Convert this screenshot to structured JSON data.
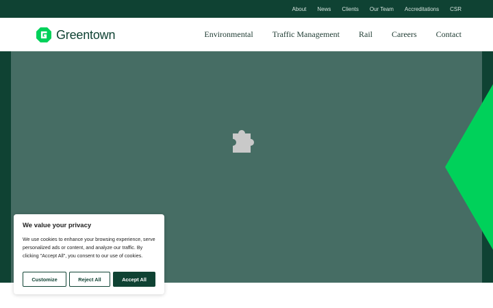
{
  "topbar": {
    "links": [
      "About",
      "News",
      "Clients",
      "Our Team",
      "Accreditations",
      "CSR"
    ]
  },
  "header": {
    "brand": "Greentown",
    "nav": [
      "Environmental",
      "Traffic Management",
      "Rail",
      "Careers",
      "Contact"
    ]
  },
  "hero": {
    "icon": "puzzle-piece-icon"
  },
  "cookie": {
    "title": "We value your privacy",
    "text": "We use cookies to enhance your browsing experience, serve personalized ads or content, and analyze our traffic. By clicking \"Accept All\", you consent to our use of cookies.",
    "customize": "Customize",
    "reject": "Reject All",
    "accept": "Accept All"
  },
  "colors": {
    "brand_dark": "#0f4233",
    "accent_green": "#00d15a",
    "hero_panel": "#466d64"
  }
}
